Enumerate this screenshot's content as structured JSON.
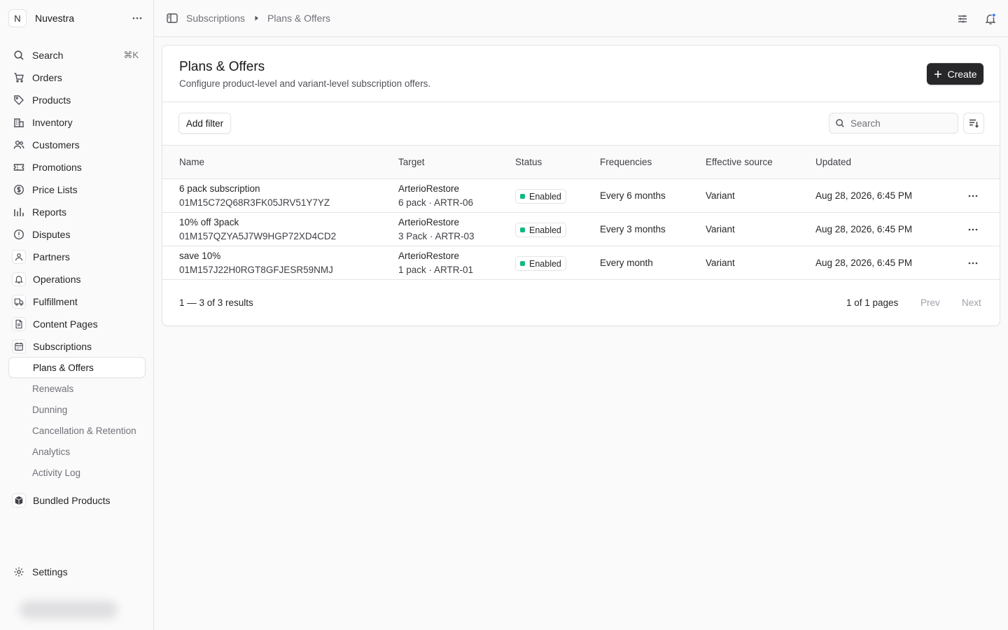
{
  "store": {
    "initial": "N",
    "name": "Nuvestra"
  },
  "sidebar": {
    "search": {
      "label": "Search",
      "shortcut": "⌘K"
    },
    "items": [
      {
        "label": "Orders",
        "icon": "cart-icon"
      },
      {
        "label": "Products",
        "icon": "tag-icon"
      },
      {
        "label": "Inventory",
        "icon": "building-icon"
      },
      {
        "label": "Customers",
        "icon": "users-icon"
      },
      {
        "label": "Promotions",
        "icon": "ticket-icon"
      },
      {
        "label": "Price Lists",
        "icon": "currency-icon"
      },
      {
        "label": "Reports",
        "icon": "bar-chart-icon"
      },
      {
        "label": "Disputes",
        "icon": "alert-circle-icon"
      },
      {
        "label": "Partners",
        "icon": "partners-icon"
      },
      {
        "label": "Operations",
        "icon": "bell-icon"
      },
      {
        "label": "Fulfillment",
        "icon": "truck-icon"
      },
      {
        "label": "Content Pages",
        "icon": "document-icon"
      },
      {
        "label": "Subscriptions",
        "icon": "calendar-icon"
      }
    ],
    "subscriptions_sub": [
      {
        "label": "Plans & Offers",
        "active": true
      },
      {
        "label": "Renewals"
      },
      {
        "label": "Dunning"
      },
      {
        "label": "Cancellation & Retention"
      },
      {
        "label": "Analytics"
      },
      {
        "label": "Activity Log"
      }
    ],
    "bundled": {
      "label": "Bundled Products",
      "icon": "box-icon"
    },
    "settings": {
      "label": "Settings",
      "icon": "gear-icon"
    }
  },
  "breadcrumb": {
    "parent": "Subscriptions",
    "current": "Plans & Offers"
  },
  "page": {
    "title": "Plans & Offers",
    "subtitle": "Configure product-level and variant-level subscription offers.",
    "create_label": "Create",
    "add_filter_label": "Add filter",
    "search_placeholder": "Search"
  },
  "table": {
    "columns": [
      "Name",
      "Target",
      "Status",
      "Frequencies",
      "Effective source",
      "Updated"
    ],
    "rows": [
      {
        "name": "6 pack subscription",
        "id": "01M15C72Q68R3FK05JRV51Y7YZ",
        "target_product": "ArterioRestore",
        "target_variant": "6 pack · ARTR-06",
        "status": "Enabled",
        "frequency": "Every 6 months",
        "source": "Variant",
        "updated": "Aug 28, 2026, 6:45 PM"
      },
      {
        "name": "10% off 3pack",
        "id": "01M157QZYA5J7W9HGP72XD4CD2",
        "target_product": "ArterioRestore",
        "target_variant": "3 Pack · ARTR-03",
        "status": "Enabled",
        "frequency": "Every 3 months",
        "source": "Variant",
        "updated": "Aug 28, 2026, 6:45 PM"
      },
      {
        "name": "save 10%",
        "id": "01M157J22H0RGT8GFJESR59NMJ",
        "target_product": "ArterioRestore",
        "target_variant": "1 pack · ARTR-01",
        "status": "Enabled",
        "frequency": "Every month",
        "source": "Variant",
        "updated": "Aug 28, 2026, 6:45 PM"
      }
    ]
  },
  "pagination": {
    "count": "1 — 3 of 3 results",
    "pages": "1 of 1 pages",
    "prev": "Prev",
    "next": "Next"
  },
  "colors": {
    "enabled": "#10b981",
    "primary_button": "#27272a"
  }
}
